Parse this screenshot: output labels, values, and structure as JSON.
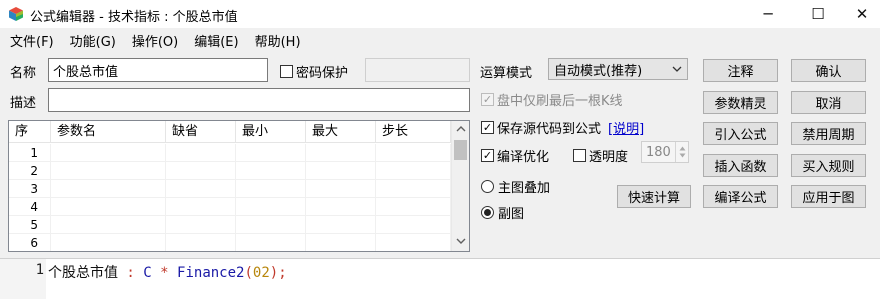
{
  "window": {
    "title": "公式编辑器 - 技术指标 : 个股总市值",
    "minimize_glyph": "─",
    "maximize_glyph": "☐",
    "close_glyph": "✕"
  },
  "menu": [
    "文件(F)",
    "功能(G)",
    "操作(O)",
    "编辑(E)",
    "帮助(H)"
  ],
  "form": {
    "name_label": "名称",
    "name_value": "个股总市值",
    "password_label": "密码保护",
    "password_checked": false,
    "desc_label": "描述",
    "desc_value": ""
  },
  "table": {
    "headers": [
      "序",
      "参数名",
      "缺省",
      "最小",
      "最大",
      "步长"
    ],
    "rows": [
      "1",
      "2",
      "3",
      "4",
      "5",
      "6"
    ]
  },
  "options": {
    "mode_label": "运算模式",
    "mode_value": "自动模式(推荐)",
    "refresh_last_label": "盘中仅刷最后一根K线",
    "refresh_last_checked": true,
    "refresh_last_disabled": true,
    "save_source_label": "保存源代码到公式",
    "explain_link": "[说明]",
    "save_source_checked": true,
    "compile_opt_label": "编译优化",
    "compile_opt_checked": true,
    "transparency_label": "透明度",
    "transparency_checked": false,
    "transparency_value": "180",
    "overlay_main_label": "主图叠加",
    "sub_chart_label": "副图",
    "selected_chart": "副图",
    "quick_calc_label": "快速计算"
  },
  "buttons": {
    "comment": "注释",
    "confirm": "确认",
    "param_wizard": "参数精灵",
    "cancel": "取消",
    "import_formula": "引入公式",
    "disable_period": "禁用周期",
    "insert_function": "插入函数",
    "buy_rule": "买入规则",
    "compile_formula": "编译公式",
    "apply_to_chart": "应用于图"
  },
  "editor": {
    "line_number": "1",
    "tokens": {
      "name": "个股总市值",
      "op1": " : ",
      "var": "C",
      "op2": " * ",
      "fn": "Finance2",
      "paren_open": "(",
      "arg": "02",
      "paren_close": ");"
    }
  },
  "icons": {
    "app": "formula-editor-icon",
    "dropdown": "chevron-down-icon",
    "check": "✓"
  }
}
